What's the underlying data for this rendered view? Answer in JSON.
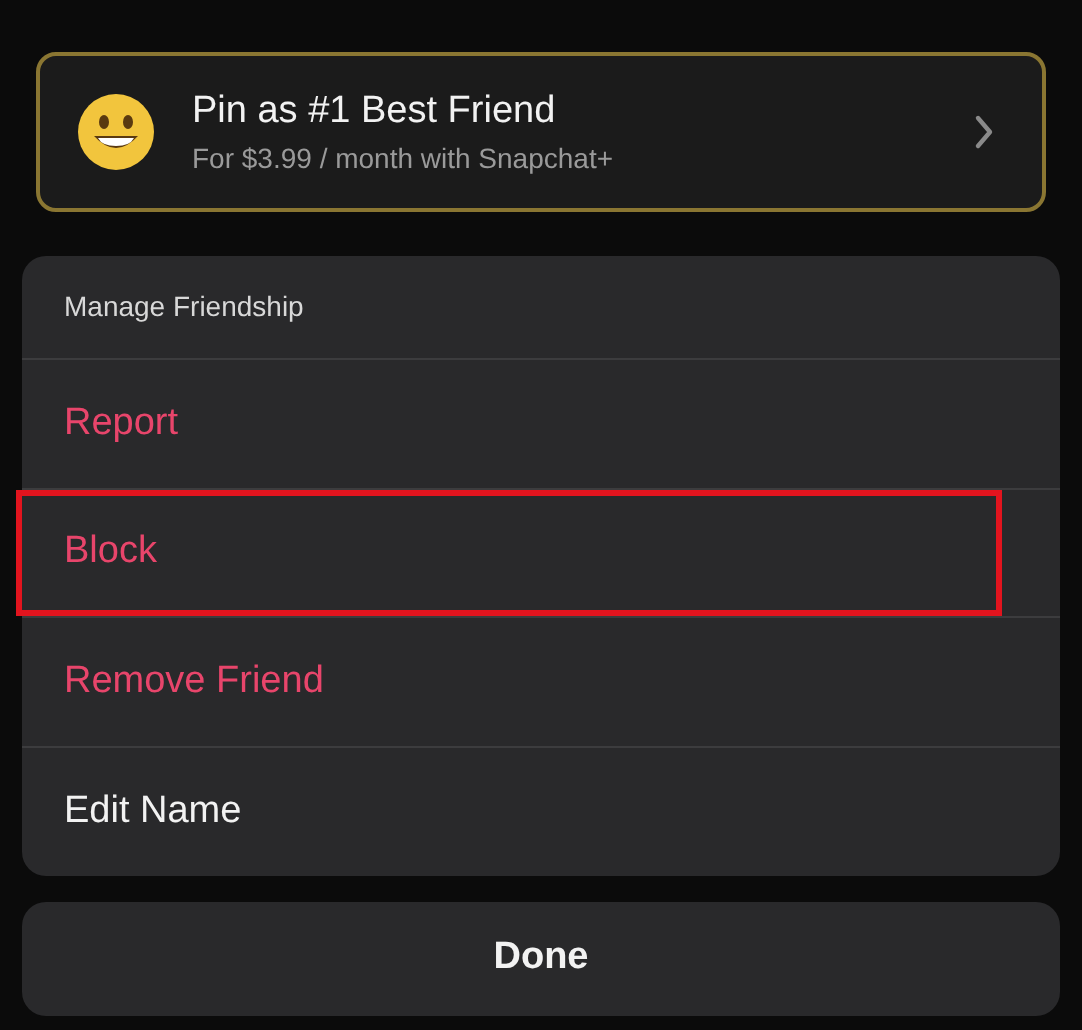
{
  "promo": {
    "title": "Pin as #1 Best Friend",
    "subtitle": "For $3.99 / month with Snapchat+"
  },
  "menu": {
    "header": "Manage Friendship",
    "items": [
      {
        "label": "Report",
        "kind": "destructive",
        "highlighted": false
      },
      {
        "label": "Block",
        "kind": "destructive",
        "highlighted": true
      },
      {
        "label": "Remove Friend",
        "kind": "destructive",
        "highlighted": false
      },
      {
        "label": "Edit Name",
        "kind": "normal",
        "highlighted": false
      }
    ]
  },
  "done_button": "Done"
}
